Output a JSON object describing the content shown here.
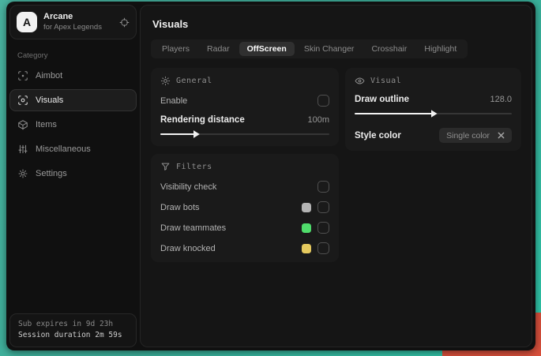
{
  "brand": {
    "logo_letter": "A",
    "title": "Arcane",
    "subtitle": "for Apex Legends"
  },
  "sidebar": {
    "category_label": "Category",
    "items": [
      {
        "label": "Aimbot"
      },
      {
        "label": "Visuals"
      },
      {
        "label": "Items"
      },
      {
        "label": "Miscellaneous"
      },
      {
        "label": "Settings"
      }
    ],
    "footer": {
      "sub_expires": "Sub expires in 9d 23h",
      "session_duration": "Session duration 2m 59s"
    }
  },
  "main": {
    "page_title": "Visuals",
    "tabs": [
      {
        "label": "Players"
      },
      {
        "label": "Radar"
      },
      {
        "label": "OffScreen"
      },
      {
        "label": "Skin Changer"
      },
      {
        "label": "Crosshair"
      },
      {
        "label": "Highlight"
      }
    ],
    "general": {
      "title": "General",
      "enable_label": "Enable",
      "rendering_distance_label": "Rendering distance",
      "rendering_distance_value": "100m",
      "rendering_distance_fill": "20%"
    },
    "visual": {
      "title": "Visual",
      "draw_outline_label": "Draw outline",
      "draw_outline_value": "128.0",
      "draw_outline_fill": "49%",
      "style_color_label": "Style color",
      "style_color_value": "Single color"
    },
    "filters": {
      "title": "Filters",
      "rows": [
        {
          "label": "Visibility check"
        },
        {
          "label": "Draw bots",
          "swatch": "#b4b4b4"
        },
        {
          "label": "Draw teammates",
          "swatch": "#4fdc6b"
        },
        {
          "label": "Draw knocked",
          "swatch": "#e5c95e"
        }
      ]
    }
  },
  "colors": {
    "desktop_teal": "#3bae99",
    "desktop_red": "#d8503c",
    "accent": "#f2f2f2"
  }
}
